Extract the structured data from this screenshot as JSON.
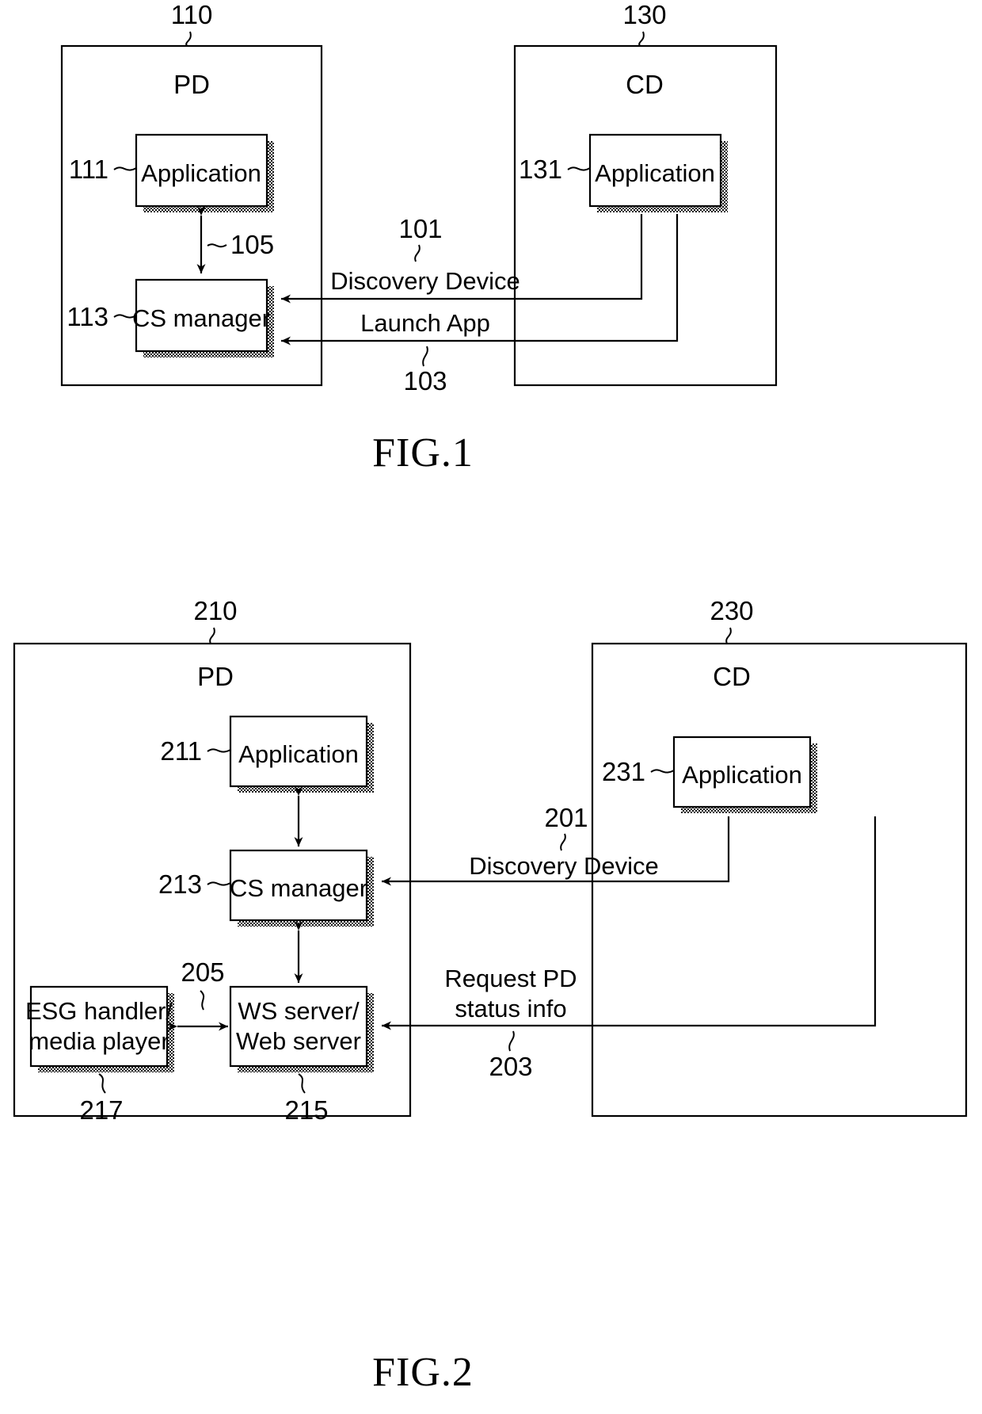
{
  "document": {
    "type": "patent-drawing-sheet",
    "figures": [
      {
        "id": "fig1",
        "caption": "FIG.1",
        "outer_blocks": [
          {
            "ref": "110",
            "label": "PD"
          },
          {
            "ref": "130",
            "label": "CD"
          }
        ],
        "inner_blocks": [
          {
            "ref": "111",
            "label": "Application"
          },
          {
            "ref": "113",
            "label": "CS manager"
          },
          {
            "ref": "131",
            "label": "Application"
          }
        ],
        "connections": [
          {
            "ref": "105",
            "label": "",
            "kind": "bidirectional"
          },
          {
            "ref": "101",
            "label": "Discovery Device",
            "kind": "cd-to-pd"
          },
          {
            "ref": "103",
            "label": "Launch App",
            "kind": "cd-to-pd"
          }
        ]
      },
      {
        "id": "fig2",
        "caption": "FIG.2",
        "outer_blocks": [
          {
            "ref": "210",
            "label": "PD"
          },
          {
            "ref": "230",
            "label": "CD"
          }
        ],
        "inner_blocks": [
          {
            "ref": "211",
            "label": "Application"
          },
          {
            "ref": "213",
            "label": "CS manager"
          },
          {
            "ref": "215",
            "label_line1": "WS server/",
            "label_line2": "Web server"
          },
          {
            "ref": "217",
            "label_line1": "ESG handler/",
            "label_line2": "media player"
          },
          {
            "ref": "231",
            "label": "Application"
          }
        ],
        "connections": [
          {
            "ref": "205",
            "label": "",
            "kind": "bidirectional"
          },
          {
            "ref": "201",
            "label": "Discovery Device",
            "kind": "cd-to-pd"
          },
          {
            "ref": "203",
            "label_line1": "Request PD",
            "label_line2": "status info",
            "kind": "cd-to-pd"
          }
        ]
      }
    ]
  },
  "fig1": {
    "caption": "FIG.1",
    "ref_110": "110",
    "ref_130": "130",
    "ref_111": "111",
    "ref_113": "113",
    "ref_131": "131",
    "ref_101": "101",
    "ref_103": "103",
    "ref_105": "105",
    "pd_label": "PD",
    "cd_label": "CD",
    "application_pd": "Application",
    "cs_manager": "CS manager",
    "application_cd": "Application",
    "discovery_device": "Discovery Device",
    "launch_app": "Launch App"
  },
  "fig2": {
    "caption": "FIG.2",
    "ref_210": "210",
    "ref_230": "230",
    "ref_211": "211",
    "ref_213": "213",
    "ref_215": "215",
    "ref_217": "217",
    "ref_231": "231",
    "ref_201": "201",
    "ref_203": "203",
    "ref_205": "205",
    "pd_label": "PD",
    "cd_label": "CD",
    "application_pd": "Application",
    "cs_manager": "CS manager",
    "application_cd": "Application",
    "ws_server_line1": "WS server/",
    "ws_server_line2": "Web server",
    "esg_line1": "ESG handler/",
    "esg_line2": "media player",
    "discovery_device": "Discovery Device",
    "request_line1": "Request PD",
    "request_line2": "status info"
  },
  "colors": {
    "ink": "#000000",
    "paper": "#ffffff",
    "shadow": "#555555"
  }
}
